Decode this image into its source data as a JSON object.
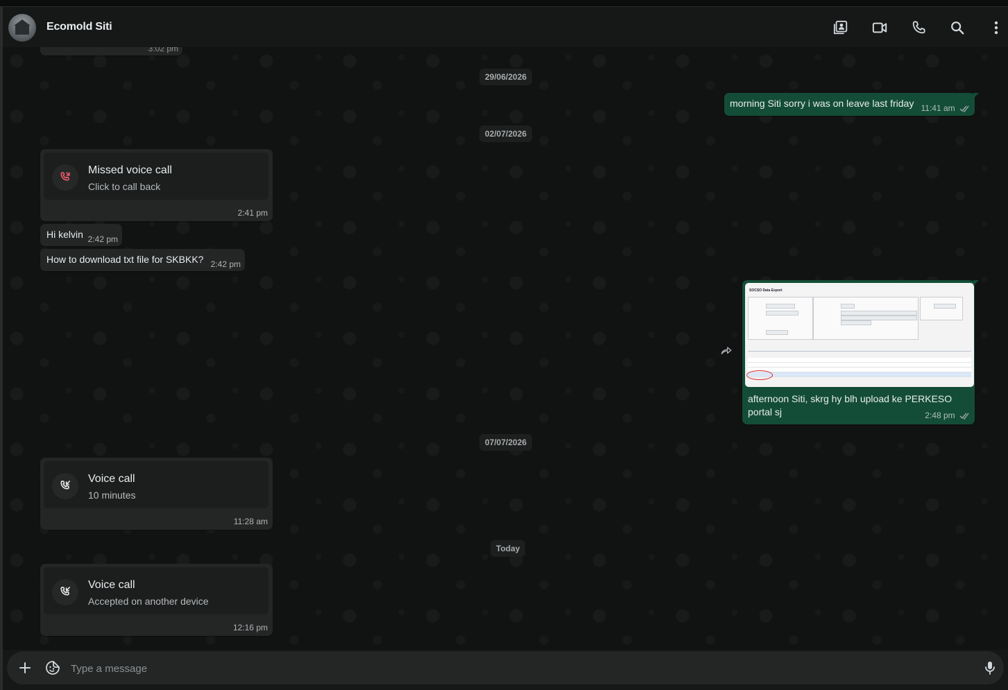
{
  "header": {
    "contact_name": "Ecomold Siti",
    "icons": [
      "contact-card-icon",
      "video-call-icon",
      "voice-call-icon",
      "search-icon",
      "more-options-icon"
    ]
  },
  "chat": {
    "partial_top_time": "3:02 pm",
    "date_1": "29/06/2026",
    "date_2": "02/07/2026",
    "date_3": "07/07/2026",
    "date_4": "Today",
    "out_msg_1": {
      "text": "morning Siti sorry i was on leave last friday",
      "time": "11:41 am",
      "status": "read"
    },
    "missed_call": {
      "title": "Missed voice call",
      "subtitle": "Click to call back",
      "time": "2:41 pm",
      "icon": "missed-call-icon",
      "icon_color": "#f15c6d"
    },
    "in_msg_1": {
      "text": "Hi kelvin",
      "time": "2:42 pm"
    },
    "in_msg_2": {
      "text": "How to download txt file for SKBKK?",
      "time": "2:42 pm"
    },
    "out_img_msg": {
      "caption_line1": "afternoon Siti, skrg hy blh upload ke PERKESO",
      "caption_line2": "portal sj",
      "time": "2:48 pm",
      "status": "read",
      "image_title": "SOCSO Data Export"
    },
    "voice_call_1": {
      "title": "Voice call",
      "subtitle": "10 minutes",
      "time": "11:28 am",
      "icon": "incoming-call-icon"
    },
    "voice_call_2": {
      "title": "Voice call",
      "subtitle": "Accepted on another device",
      "time": "12:16 pm",
      "icon": "incoming-call-icon"
    }
  },
  "composer": {
    "placeholder": "Type a message"
  },
  "colors": {
    "outgoing_bubble": "#144d37",
    "incoming_bubble": "#242626",
    "read_ticks": "#53bdeb",
    "missed_call": "#f15c6d"
  }
}
